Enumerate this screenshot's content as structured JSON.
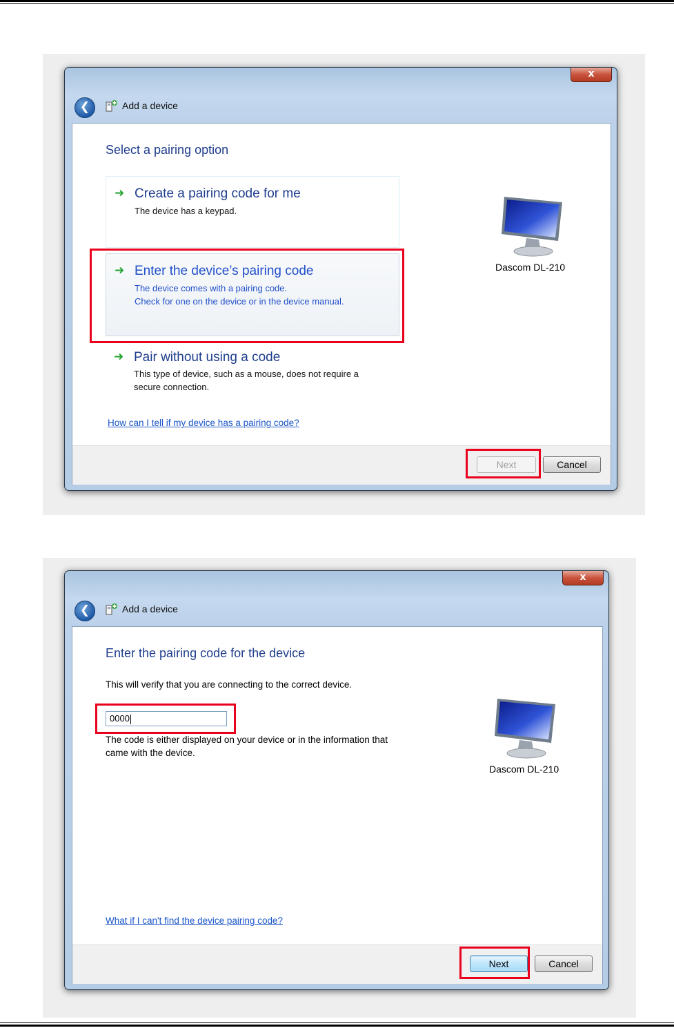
{
  "dialog1": {
    "window_title": "Add a device",
    "close_label": "x",
    "heading": "Select a pairing option",
    "options": [
      {
        "title": "Create a pairing code for me",
        "desc": [
          "The device has a keypad."
        ]
      },
      {
        "title": "Enter the device’s pairing code",
        "desc": [
          "The device comes with a pairing code.",
          "Check for one on the device or in the device manual."
        ]
      },
      {
        "title": "Pair without using a code",
        "desc": [
          "This type of device, such as a mouse, does not require a",
          "secure connection."
        ]
      }
    ],
    "help_link": "How can I tell if my device has a pairing code?",
    "device_name": "Dascom DL-210",
    "next_label": "Next",
    "cancel_label": "Cancel"
  },
  "dialog2": {
    "window_title": "Add a device",
    "close_label": "x",
    "heading": "Enter the pairing code for the device",
    "instruction": "This will verify that you are connecting to the correct device.",
    "pairing_code_value": "0000",
    "hint_lines": [
      "The code is either displayed on your device or in the information that",
      "came with the device."
    ],
    "help_link": "What if I can't find the device pairing code?",
    "device_name": "Dascom DL-210",
    "next_label": "Next",
    "cancel_label": "Cancel"
  },
  "colors": {
    "highlight": "#e8001c",
    "heading_blue": "#1e3d8c",
    "option_blue": "#1f4ec9",
    "arrow_green": "#2aa534",
    "link_blue": "#1a56c9"
  }
}
